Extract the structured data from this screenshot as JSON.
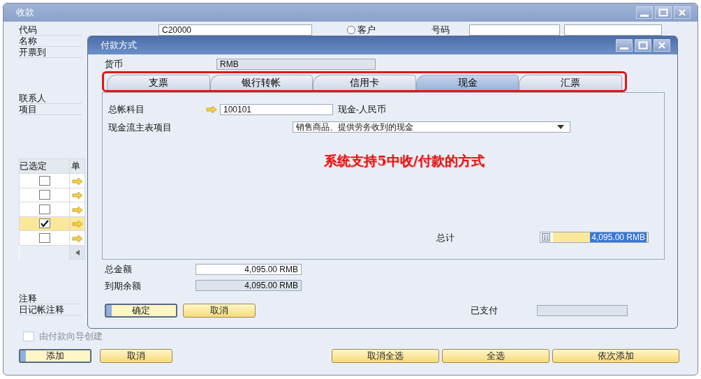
{
  "window": {
    "title": "收款"
  },
  "header": {
    "code_label": "代码",
    "code_value": "C20000",
    "radio": {
      "label": "客户",
      "selected": false
    },
    "number_label": "号码",
    "name_label": "名称",
    "bill_to_label": "开票到",
    "contact_label": "联系人",
    "project_label": "项目"
  },
  "table": {
    "columns": [
      "已选定",
      "单"
    ],
    "rows": [
      {
        "checked": false,
        "selected": false
      },
      {
        "checked": false,
        "selected": false
      },
      {
        "checked": false,
        "selected": false
      },
      {
        "checked": true,
        "selected": true
      },
      {
        "checked": false,
        "selected": false
      }
    ]
  },
  "remarks_label": "注释",
  "journal_remarks_label": "日记帐注释",
  "wizard_checkbox": {
    "label": "由付款向导创建",
    "checked": false,
    "disabled": true
  },
  "buttons_left": [
    {
      "label": "添加",
      "default": true
    },
    {
      "label": "取消",
      "default": false
    }
  ],
  "buttons_right": [
    {
      "label": "取消全选",
      "default": false
    },
    {
      "label": "全选",
      "default": false
    },
    {
      "label": "依次添加",
      "default": false
    }
  ],
  "dialog": {
    "title": "付款方式",
    "currency_label": "货币",
    "currency_value": "RMB",
    "tabs": [
      {
        "label": "支票",
        "selected": false
      },
      {
        "label": "银行转帐",
        "selected": false
      },
      {
        "label": "信用卡",
        "selected": false
      },
      {
        "label": "现金",
        "selected": true
      },
      {
        "label": "汇票",
        "selected": false
      }
    ],
    "gl_account_label": "总帐科目",
    "gl_account_value": "100101",
    "gl_account_name": "现金-人民币",
    "cash_flow_label": "现金流主表项目",
    "cash_flow_value": "销售商品、提供劳务收到的现金",
    "annotation": "系统支持5中收/付款的方式",
    "total_label": "总计",
    "total_value": "4,095.00 RMB",
    "amount_label": "总金额",
    "amount_value": "4,095.00 RMB",
    "balance_due_label": "到期余额",
    "balance_due_value": "4,095.00 RMB",
    "paid_label": "已支付",
    "buttons": [
      {
        "label": "确定",
        "default": true
      },
      {
        "label": "取消",
        "default": false
      }
    ]
  }
}
